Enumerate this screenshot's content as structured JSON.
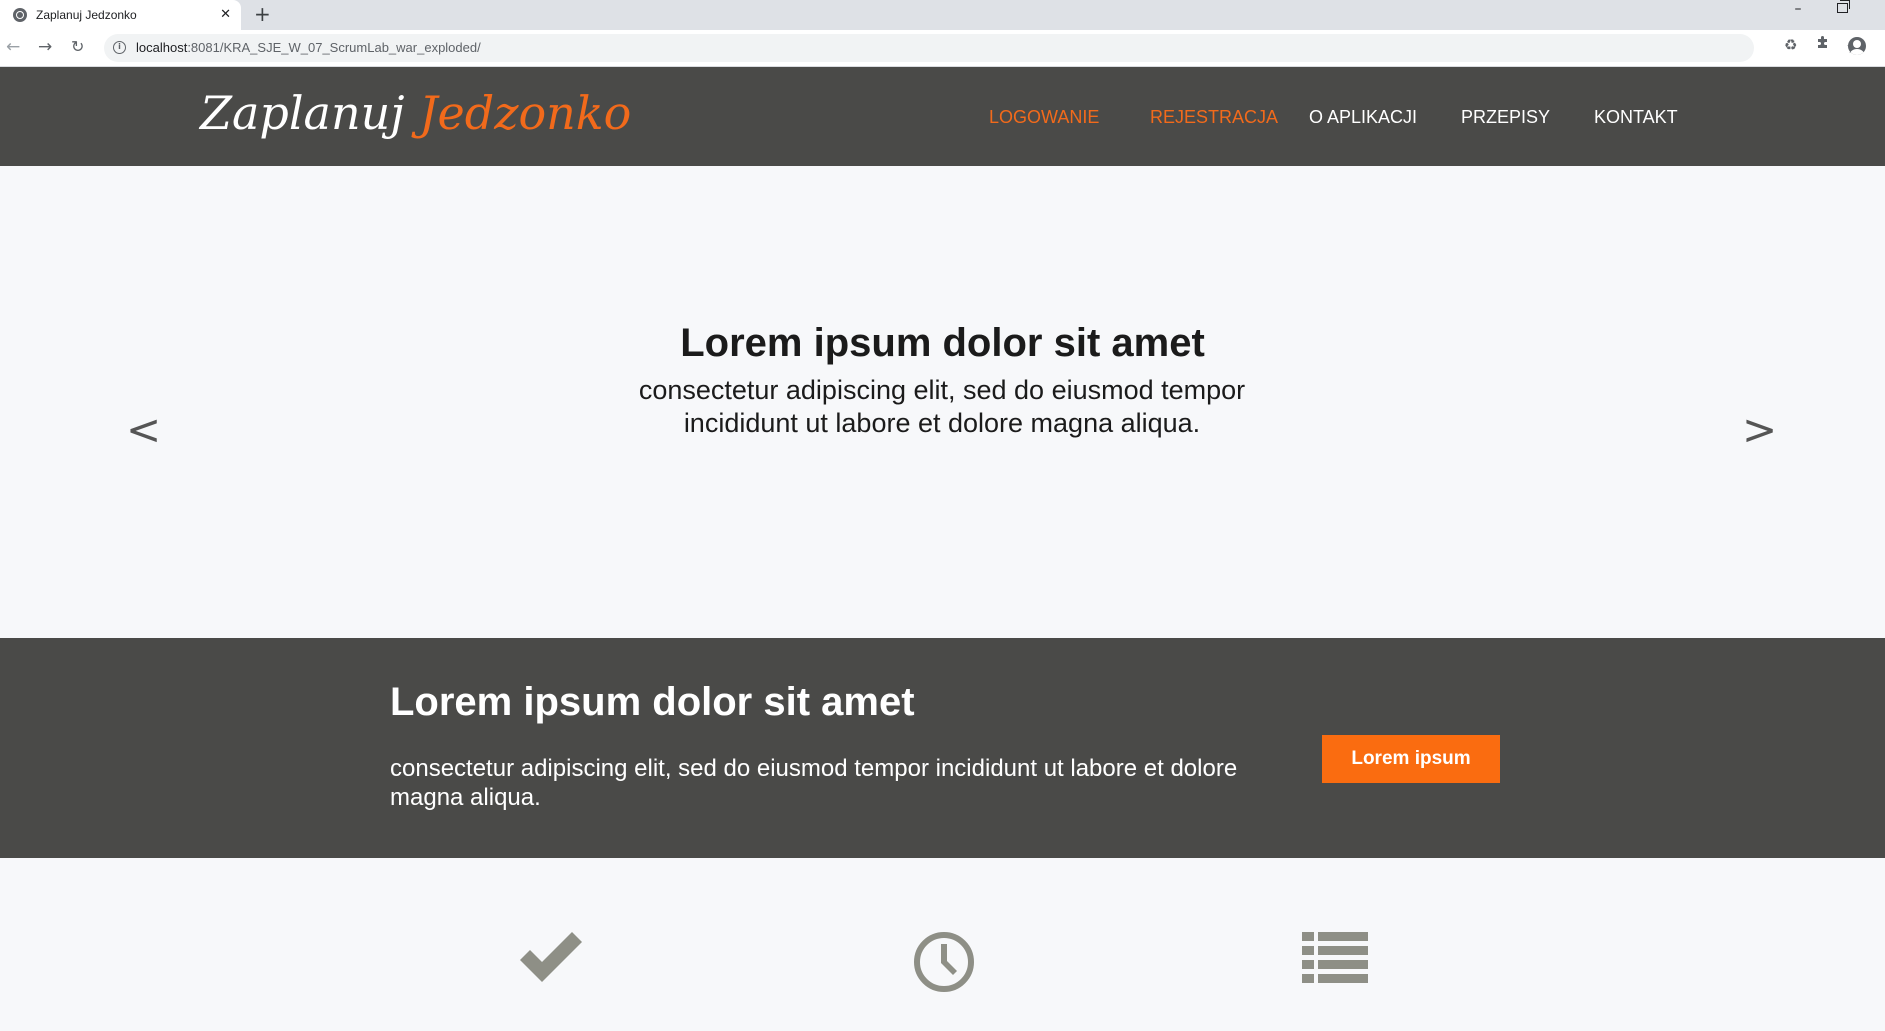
{
  "browser": {
    "tab_title": "Zaplanuj Jedzonko",
    "tab_close": "✕",
    "new_tab": "+",
    "minimize": "–",
    "url_host": "localhost",
    "url_rest": ":8081/KRA_SJE_W_07_ScrumLab_war_exploded/",
    "nav": {
      "back": "←",
      "forward": "→",
      "reload": "↻"
    },
    "icons": {
      "favicon": "globe-icon",
      "info": "info-icon",
      "bookmark": "star-icon",
      "extension1": "recycle-icon",
      "extension2": "puzzle-icon",
      "profile": "profile-icon"
    }
  },
  "header": {
    "logo_part1": "Zaplanuj",
    "logo_part2": "Jedzonko",
    "nav": [
      {
        "label": "LOGOWANIE",
        "active": true
      },
      {
        "label": "REJESTRACJA",
        "active": true
      },
      {
        "label": "O APLIKACJI",
        "active": false
      },
      {
        "label": "PRZEPISY",
        "active": false
      },
      {
        "label": "KONTAKT",
        "active": false
      }
    ]
  },
  "hero": {
    "title": "Lorem ipsum dolor sit amet",
    "text": "consectetur adipiscing elit, sed do eiusmod tempor incididunt ut labore et dolore magna aliqua.",
    "prev": "<",
    "next": ">"
  },
  "cta": {
    "title": "Lorem ipsum dolor sit amet",
    "text": "consectetur adipiscing elit, sed do eiusmod tempor incididunt ut labore et dolore magna aliqua.",
    "button": "Lorem ipsum"
  },
  "features": {
    "icons": [
      "check-icon",
      "clock-icon",
      "list-icon"
    ]
  },
  "colors": {
    "accent": "#f26a1b",
    "button": "#fa6c10",
    "dark_band": "#4a4a48",
    "light_bg": "#f7f8fa",
    "icon_gray": "#8e8f86"
  }
}
